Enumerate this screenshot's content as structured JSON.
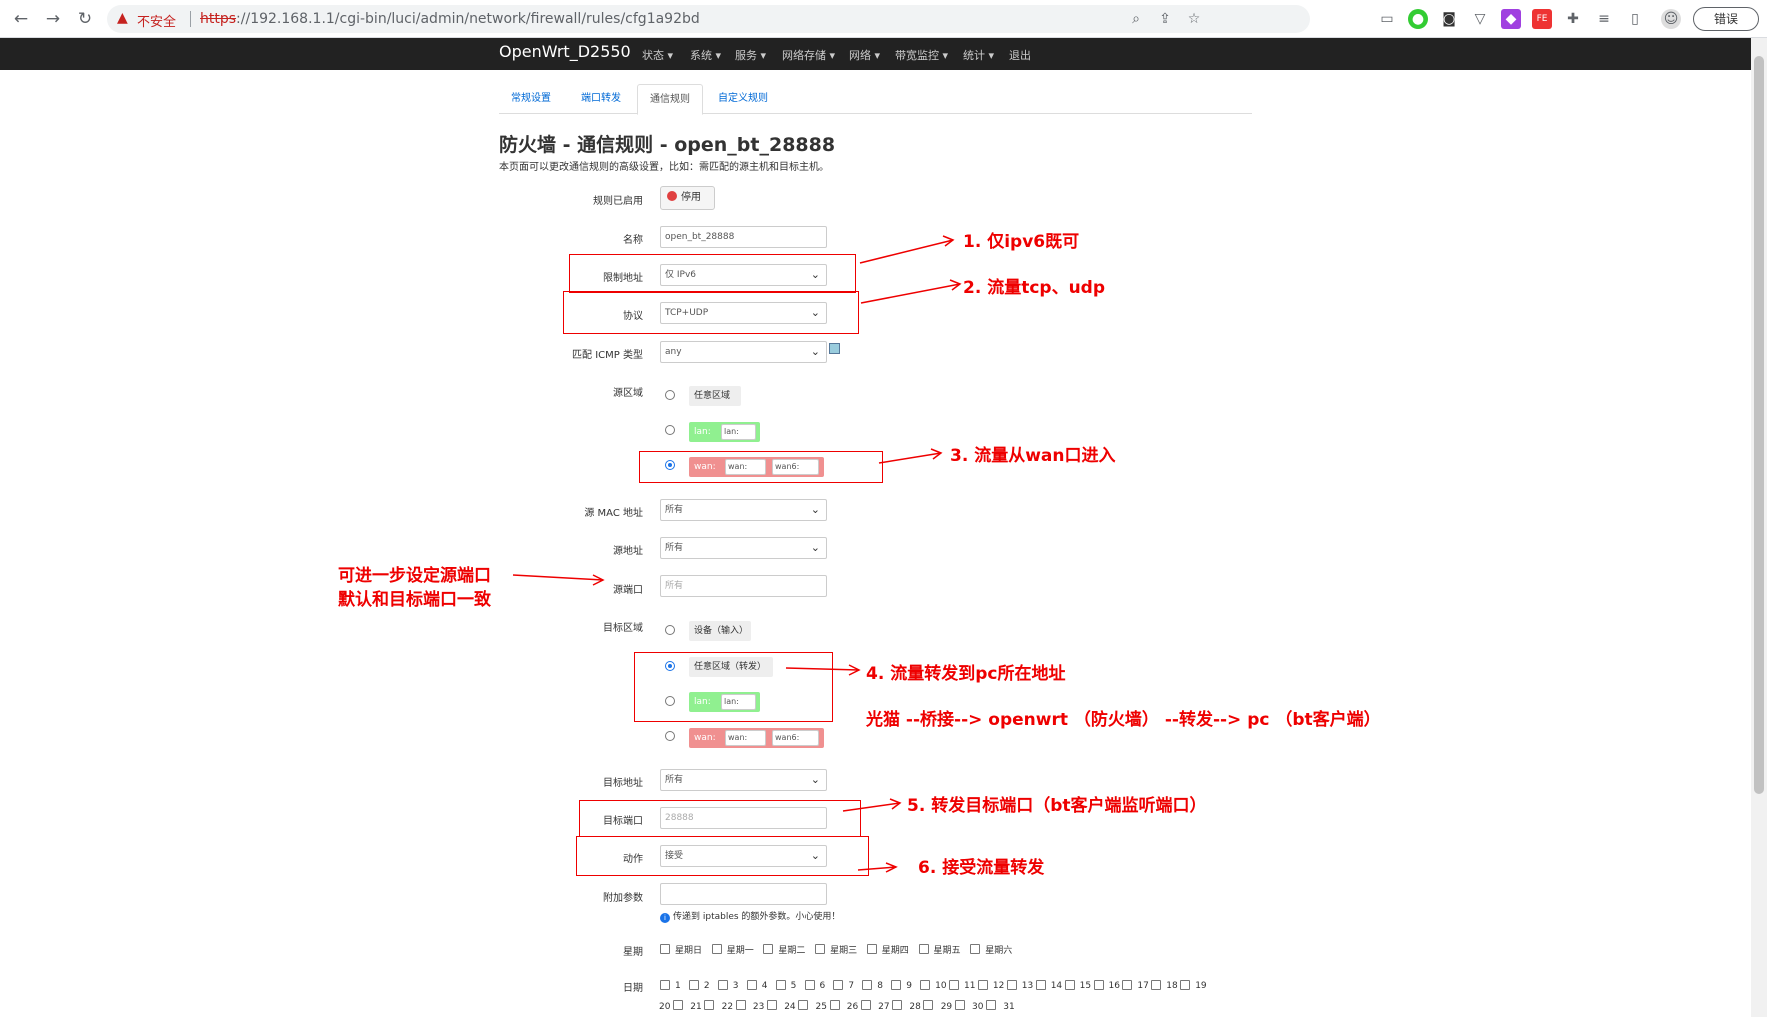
{
  "browser": {
    "insecure_label": "不安全",
    "url_proto": "https",
    "url_rest": "://192.168.1.1/cgi-bin/luci/admin/network/firewall/rules/cfg1a92bd",
    "error_button": "错误"
  },
  "topbar": {
    "brand": "OpenWrt_D2550",
    "menu": [
      "状态 ▾",
      "系统 ▾",
      "服务 ▾",
      "网络存储 ▾",
      "网络 ▾",
      "带宽监控 ▾",
      "统计 ▾",
      "退出"
    ]
  },
  "tabs": [
    "常规设置",
    "端口转发",
    "通信规则",
    "自定义规则"
  ],
  "page": {
    "title": "防火墙 - 通信规则 - open_bt_28888",
    "desc": "本页面可以更改通信规则的高级设置，比如：需匹配的源主机和目标主机。"
  },
  "form": {
    "enabled_label": "规则已启用",
    "disable_button": "停用",
    "name_label": "名称",
    "name_value": "open_bt_28888",
    "family_label": "限制地址",
    "family_value": "仅 IPv6",
    "proto_label": "协议",
    "proto_value": "TCP+UDP",
    "icmp_label": "匹配 ICMP 类型",
    "icmp_value": "any",
    "src_zone_label": "源区域",
    "zone_any": "任意区域",
    "zone_lan": "lan:",
    "zone_lan_sub": "lan:",
    "zone_wan": "wan:",
    "zone_wan_sub1": "wan:",
    "zone_wan_sub2": "wan6:",
    "src_mac_label": "源 MAC 地址",
    "src_mac_value": "所有",
    "src_ip_label": "源地址",
    "src_ip_value": "所有",
    "src_port_label": "源端口",
    "src_port_placeholder": "所有",
    "dest_zone_label": "目标区域",
    "dest_device": "设备（输入）",
    "dest_any": "任意区域（转发）",
    "dest_ip_label": "目标地址",
    "dest_ip_value": "所有",
    "dest_port_label": "目标端口",
    "dest_port_value": "28888",
    "action_label": "动作",
    "action_value": "接受",
    "extra_label": "附加参数",
    "extra_help": "传递到 iptables 的额外参数。小心使用！",
    "weekday_label": "星期",
    "weekdays": [
      "星期日",
      "星期一",
      "星期二",
      "星期三",
      "星期四",
      "星期五",
      "星期六"
    ],
    "monthday_label": "日期",
    "monthdays_row1": [
      "1",
      "2",
      "3",
      "4",
      "5",
      "6",
      "7",
      "8",
      "9",
      "10",
      "11",
      "12",
      "13",
      "14",
      "15",
      "16",
      "17",
      "18",
      "19"
    ],
    "monthdays_row2": [
      "20",
      "21",
      "22",
      "23",
      "24",
      "25",
      "26",
      "27",
      "28",
      "29",
      "30",
      "31"
    ]
  },
  "annotations": {
    "a1": "1. 仅ipv6既可",
    "a2": "2. 流量tcp、udp",
    "a3": "3. 流量从wan口进入",
    "a_src_line1": "可进一步设定源端口",
    "a_src_line2": "默认和目标端口一致",
    "a4": "4. 流量转发到pc所在地址",
    "a4b": "光猫 --桥接--> openwrt （防火墙） --转发--> pc （bt客户端）",
    "a5": "5. 转发目标端口（bt客户端监听端口）",
    "a6": "6. 接受流量转发"
  }
}
